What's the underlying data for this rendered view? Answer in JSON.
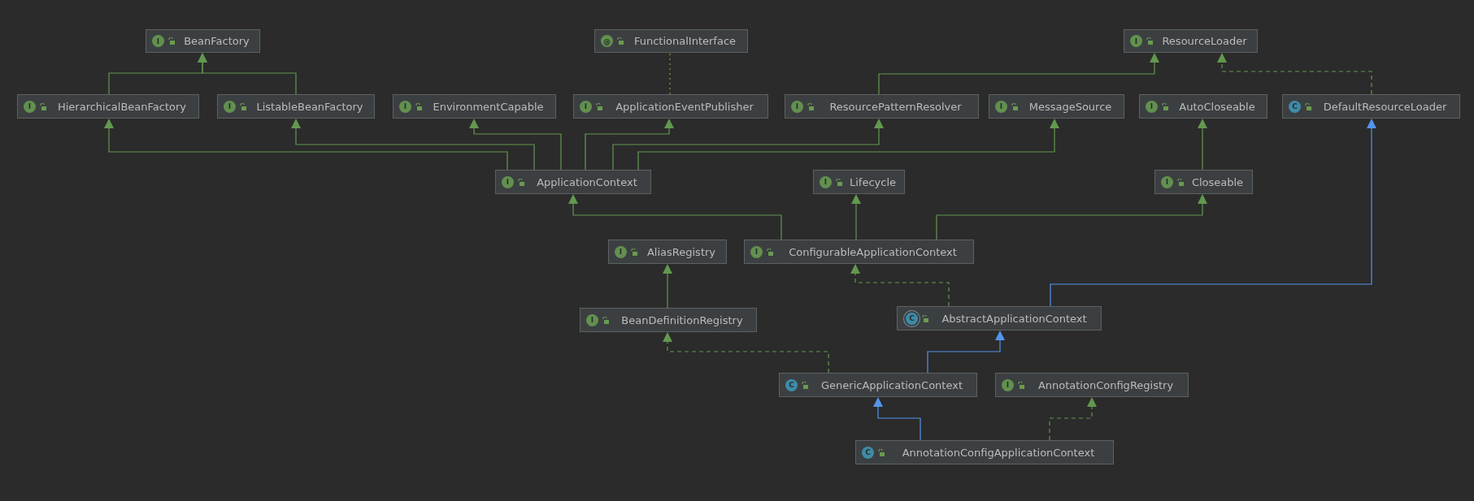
{
  "diagram": {
    "nodes": [
      {
        "name": "BeanFactory",
        "kind": "interface",
        "badge": "I"
      },
      {
        "name": "FunctionalInterface",
        "kind": "annotation",
        "badge": "@"
      },
      {
        "name": "ResourceLoader",
        "kind": "interface",
        "badge": "I"
      },
      {
        "name": "HierarchicalBeanFactory",
        "kind": "interface",
        "badge": "I"
      },
      {
        "name": "ListableBeanFactory",
        "kind": "interface",
        "badge": "I"
      },
      {
        "name": "EnvironmentCapable",
        "kind": "interface",
        "badge": "I"
      },
      {
        "name": "ApplicationEventPublisher",
        "kind": "interface",
        "badge": "I"
      },
      {
        "name": "ResourcePatternResolver",
        "kind": "interface",
        "badge": "I"
      },
      {
        "name": "MessageSource",
        "kind": "interface",
        "badge": "I"
      },
      {
        "name": "AutoCloseable",
        "kind": "interface",
        "badge": "I"
      },
      {
        "name": "DefaultResourceLoader",
        "kind": "class",
        "badge": "C"
      },
      {
        "name": "ApplicationContext",
        "kind": "interface",
        "badge": "I"
      },
      {
        "name": "Lifecycle",
        "kind": "interface",
        "badge": "I"
      },
      {
        "name": "Closeable",
        "kind": "interface",
        "badge": "I"
      },
      {
        "name": "AliasRegistry",
        "kind": "interface",
        "badge": "I"
      },
      {
        "name": "ConfigurableApplicationContext",
        "kind": "interface",
        "badge": "I"
      },
      {
        "name": "BeanDefinitionRegistry",
        "kind": "interface",
        "badge": "I"
      },
      {
        "name": "AbstractApplicationContext",
        "kind": "abstract",
        "badge": "C"
      },
      {
        "name": "GenericApplicationContext",
        "kind": "class",
        "badge": "C"
      },
      {
        "name": "AnnotationConfigRegistry",
        "kind": "interface",
        "badge": "I"
      },
      {
        "name": "AnnotationConfigApplicationContext",
        "kind": "class",
        "badge": "C"
      }
    ],
    "edges": [
      {
        "kind": "extends"
      },
      {
        "kind": "extends"
      },
      {
        "kind": "extends"
      },
      {
        "kind": "extends"
      },
      {
        "kind": "extends"
      },
      {
        "kind": "extends"
      },
      {
        "kind": "extends"
      },
      {
        "kind": "extends"
      },
      {
        "kind": "annotation"
      },
      {
        "kind": "extends"
      },
      {
        "kind": "implements"
      },
      {
        "kind": "extends"
      },
      {
        "kind": "extends"
      },
      {
        "kind": "extends"
      },
      {
        "kind": "extends"
      },
      {
        "kind": "extends"
      },
      {
        "kind": "implements"
      },
      {
        "kind": "class_extends"
      },
      {
        "kind": "class_extends"
      },
      {
        "kind": "implements"
      },
      {
        "kind": "class_extends"
      },
      {
        "kind": "implements"
      }
    ]
  }
}
